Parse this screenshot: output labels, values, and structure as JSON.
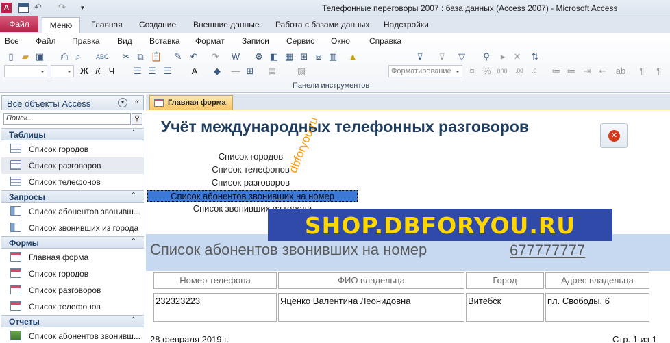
{
  "window": {
    "title": "Телефонные переговоры 2007 : база данных (Access 2007)  -  Microsoft Access"
  },
  "ribbon_tabs": {
    "file": "Файл",
    "menu": "Меню",
    "items": [
      "Главная",
      "Создание",
      "Внешние данные",
      "Работа с базами данных",
      "Надстройки"
    ]
  },
  "menu_bar": [
    "Все",
    "Файл",
    "Правка",
    "Вид",
    "Вставка",
    "Формат",
    "Записи",
    "Сервис",
    "Окно",
    "Справка"
  ],
  "toolbar": {
    "format_combo": "Форматирование",
    "group_label": "Панели инструментов"
  },
  "nav": {
    "title": "Все объекты Access",
    "search_placeholder": "Поиск...",
    "sections": [
      {
        "label": "Таблицы",
        "items": [
          "Список городов",
          "Список разговоров",
          "Список телефонов"
        ]
      },
      {
        "label": "Запросы",
        "items": [
          "Список абонентов звонивш...",
          "Список звонивших из города"
        ]
      },
      {
        "label": "Формы",
        "items": [
          "Главная форма",
          "Список городов",
          "Список разговоров",
          "Список телефонов"
        ]
      },
      {
        "label": "Отчеты",
        "items": [
          "Список абонентов звонивш..."
        ]
      }
    ]
  },
  "doc_tab": {
    "label": "Главная форма"
  },
  "form": {
    "title": "Учёт международных телефонных разговоров",
    "links": [
      "Список городов",
      "Список телефонов",
      "Список разговоров",
      "Список абонентов звонивших на номер",
      "Список звонивших из города"
    ]
  },
  "watermark": {
    "diagonal": "dbforyou.ru",
    "banner": "SHOP.DBFORYOU.RU"
  },
  "report": {
    "title": "Список абонентов звонивших на номер",
    "number": "677777777",
    "columns": [
      "Номер телефона",
      "ФИО владельца",
      "Город",
      "Адрес владельца"
    ],
    "rows": [
      [
        "232323223",
        "Яценко Валентина Леонидовна",
        "Витебск",
        "пл. Свободы, 6"
      ]
    ],
    "date": "28 февраля 2019 г.",
    "page": "Стр. 1 из 1"
  },
  "colors": {
    "accent": "#1f3d5f",
    "banner_bg": "#2f4aa8",
    "banner_text": "#ffd700",
    "selection": "#3b78d8",
    "file_tab": "#b8214a"
  }
}
